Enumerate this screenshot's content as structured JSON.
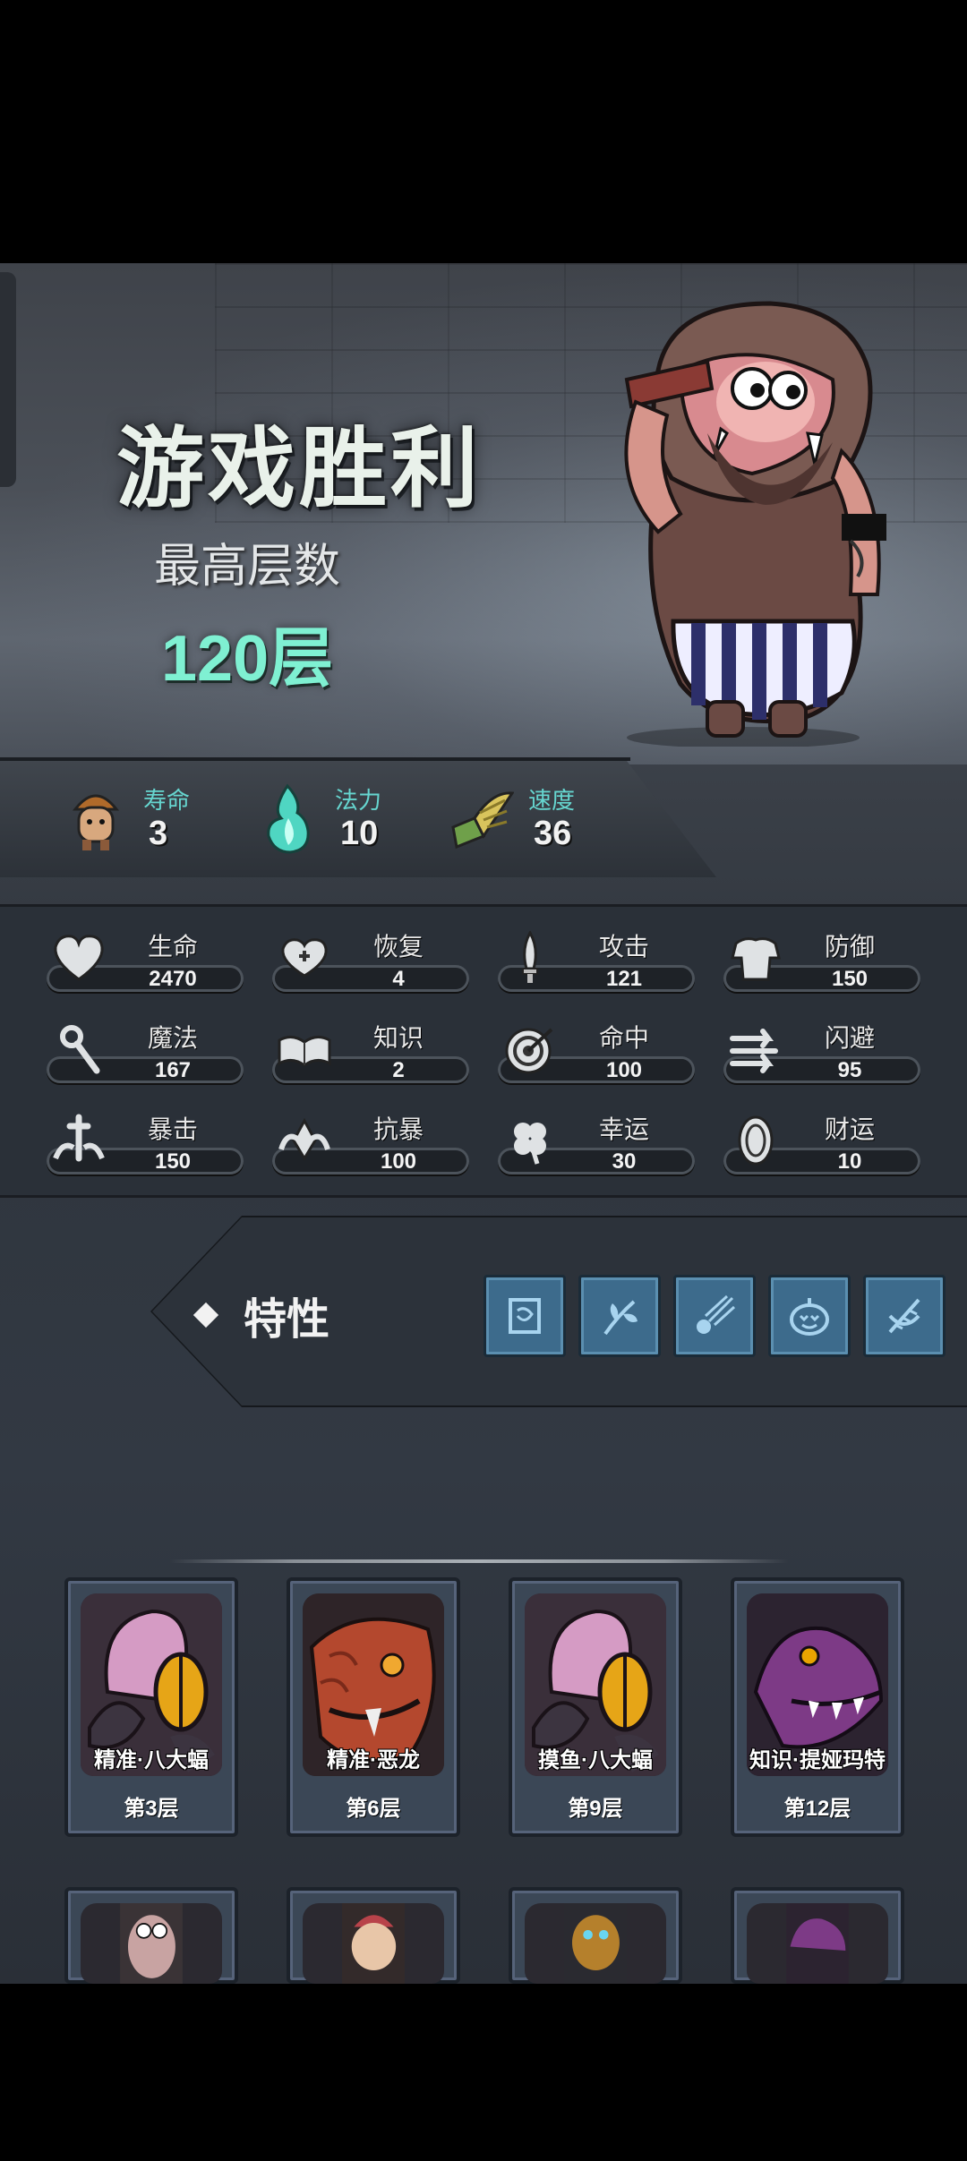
{
  "hero": {
    "title": "游戏胜利",
    "best_label": "最高层数",
    "best_value": "120层"
  },
  "base_stats": [
    {
      "label": "寿命",
      "value": "3",
      "icon": "monk-icon"
    },
    {
      "label": "法力",
      "value": "10",
      "icon": "flame-icon"
    },
    {
      "label": "速度",
      "value": "36",
      "icon": "winged-boot-icon"
    }
  ],
  "attributes": [
    {
      "name": "生命",
      "value": "2470",
      "icon": "heart-icon"
    },
    {
      "name": "恢复",
      "value": "4",
      "icon": "heart-plus-icon"
    },
    {
      "name": "攻击",
      "value": "121",
      "icon": "sword-icon"
    },
    {
      "name": "防御",
      "value": "150",
      "icon": "armor-icon"
    },
    {
      "name": "魔法",
      "value": "167",
      "icon": "staff-icon"
    },
    {
      "name": "知识",
      "value": "2",
      "icon": "book-icon"
    },
    {
      "name": "命中",
      "value": "100",
      "icon": "target-icon"
    },
    {
      "name": "闪避",
      "value": "95",
      "icon": "dodge-arrows-icon"
    },
    {
      "name": "暴击",
      "value": "150",
      "icon": "crit-icon"
    },
    {
      "name": "抗暴",
      "value": "100",
      "icon": "crit-resist-icon"
    },
    {
      "name": "幸运",
      "value": "30",
      "icon": "clover-icon"
    },
    {
      "name": "财运",
      "value": "10",
      "icon": "coin-icon"
    }
  ],
  "traits": {
    "title": "特性",
    "icons": [
      "scroll-trait-icon",
      "herb-trait-icon",
      "comet-trait-icon",
      "pumpkin-trait-icon",
      "dna-trait-icon"
    ]
  },
  "bosses": [
    {
      "name": "精准·八大蝠",
      "floor": "第3层",
      "portrait": "bat-portrait"
    },
    {
      "name": "精准·恶龙",
      "floor": "第6层",
      "portrait": "dragon-portrait"
    },
    {
      "name": "摸鱼·八大蝠",
      "floor": "第9层",
      "portrait": "bat-portrait"
    },
    {
      "name": "知识·提娅玛特",
      "floor": "第12层",
      "portrait": "croc-portrait"
    }
  ],
  "colors": {
    "accent_teal": "#66d6d0",
    "best_value": "#7ff0d2",
    "trait_blue": "#3d6b8c"
  }
}
